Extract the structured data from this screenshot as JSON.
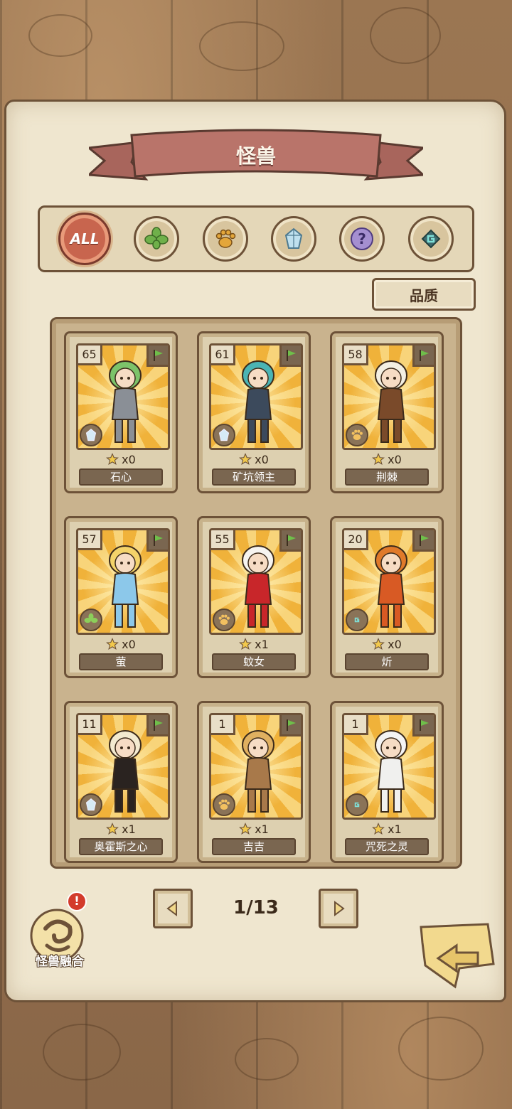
{
  "header": {
    "title": "怪兽"
  },
  "filters": [
    {
      "id": "all",
      "label": "ALL",
      "active": true,
      "icon": "all-icon"
    },
    {
      "id": "plant",
      "active": false,
      "icon": "clover-icon"
    },
    {
      "id": "beast",
      "active": false,
      "icon": "paw-icon"
    },
    {
      "id": "crystal",
      "active": false,
      "icon": "crystal-icon"
    },
    {
      "id": "unknown",
      "active": false,
      "icon": "question-icon"
    },
    {
      "id": "spirit",
      "active": false,
      "icon": "spiral-icon"
    }
  ],
  "sort": {
    "label": "品质"
  },
  "cards": [
    {
      "level": "65",
      "count": "x0",
      "name": "石心",
      "element": "crystal-icon",
      "hair": "#7cc36a",
      "body": "#8a8f96"
    },
    {
      "level": "61",
      "count": "x0",
      "name": "矿坑领主",
      "element": "crystal-icon",
      "hair": "#4bb4b4",
      "body": "#3c4a5c"
    },
    {
      "level": "58",
      "count": "x0",
      "name": "荆棘",
      "element": "paw-icon",
      "hair": "#f3efe2",
      "body": "#7a4a2a"
    },
    {
      "level": "57",
      "count": "x0",
      "name": "萤",
      "element": "clover-icon",
      "hair": "#f4d36a",
      "body": "#8cc8ea"
    },
    {
      "level": "55",
      "count": "x1",
      "name": "蚊女",
      "element": "paw-icon",
      "hair": "#f6f4f0",
      "body": "#c8262a"
    },
    {
      "level": "20",
      "count": "x0",
      "name": "炘",
      "element": "spiral-icon",
      "hair": "#e07a2a",
      "body": "#d85a24"
    },
    {
      "level": "11",
      "count": "x1",
      "name": "奥霍斯之心",
      "element": "crystal-icon",
      "hair": "#f3ead0",
      "body": "#2a2320"
    },
    {
      "level": "1",
      "count": "x1",
      "name": "吉吉",
      "element": "paw-icon",
      "hair": "#e0b060",
      "body": "#a8794a"
    },
    {
      "level": "1",
      "count": "x1",
      "name": "咒死之灵",
      "element": "spiral-icon",
      "hair": "#f4f4f4",
      "body": "#f0f0ee"
    }
  ],
  "pagination": {
    "label": "1/13"
  },
  "fusion": {
    "label": "怪兽融合",
    "alert": "!"
  },
  "colors": {
    "accent_red": "#c8654e",
    "paper": "#efe6cf",
    "card_gold": "#f0b23a",
    "outline": "#6d5238"
  }
}
